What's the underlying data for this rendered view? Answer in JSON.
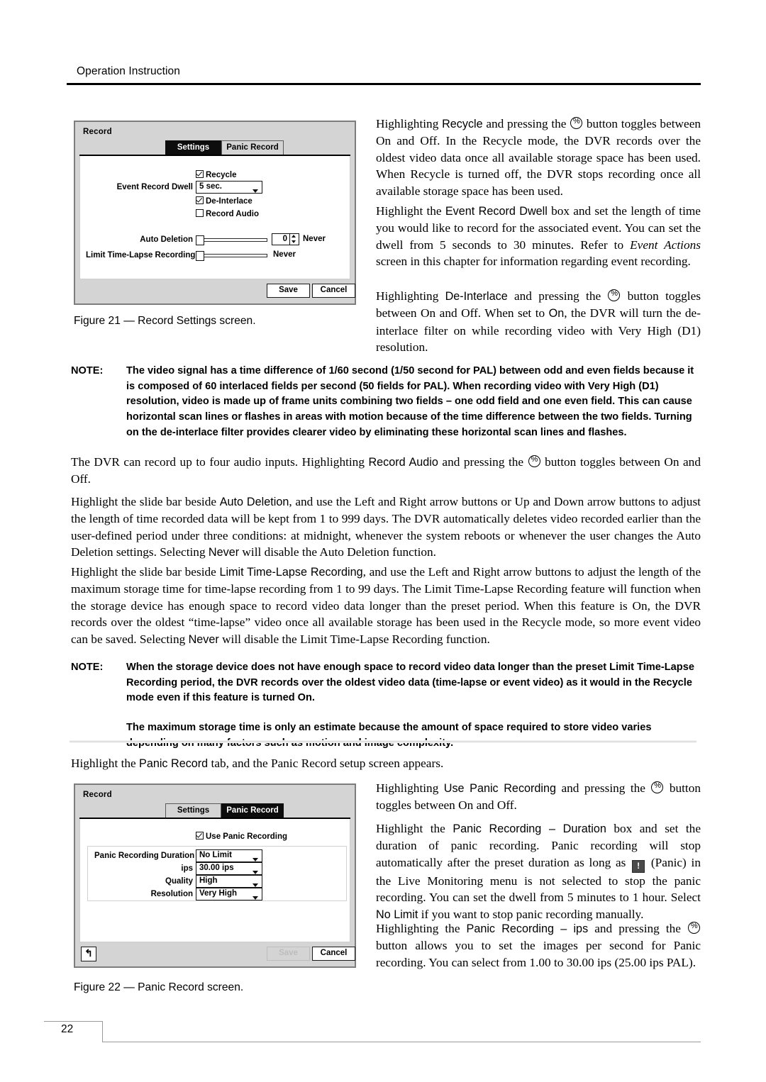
{
  "header": {
    "running_head": "Operation Instruction"
  },
  "paragraphs": {
    "p_recycle_1": "Highlighting ",
    "p_recycle_term": "Recycle",
    "p_recycle_2": " and pressing the ",
    "p_recycle_3": " button toggles between On and Off.  In the Recycle mode, the DVR records over the oldest video data once all available storage space has been used.  When Recycle is turned off, the DVR stops recording once all available storage space has been used.",
    "p_dwell_1": "Highlight the ",
    "p_dwell_term": "Event Record Dwell",
    "p_dwell_2": " box and set the length of time you would like to record for the associated event.  You can set the dwell from 5 seconds to 30 minutes.  Refer to ",
    "p_dwell_italic": "Event Actions",
    "p_dwell_3": " screen in this chapter for information regarding event recording.",
    "p_deint_1": "Highlighting ",
    "p_deint_term": "De-Interlace",
    "p_deint_2": " and pressing the ",
    "p_deint_3": " button toggles between On and Off.  When set to ",
    "p_deint_on": "On",
    "p_deint_4": ", the DVR will turn the de-interlace filter on while recording video with Very High (D1) resolution.",
    "p_audio_1": "The DVR can record up to four audio inputs.  Highlighting ",
    "p_audio_term": "Record Audio",
    "p_audio_2": " and pressing the ",
    "p_audio_3": " button toggles between On and Off.",
    "p_autodel_1": "Highlight the slide bar beside ",
    "p_autodel_term": "Auto Deletion",
    "p_autodel_2": ", and use the Left and Right arrow buttons or Up and Down arrow buttons to adjust the length of time recorded data will be kept from 1 to 999 days.  The DVR automatically deletes video recorded earlier than the user-defined period under three conditions: at midnight, whenever the system reboots or whenever the user changes the Auto Deletion settings.  Selecting ",
    "p_autodel_never": "Never",
    "p_autodel_3": " will disable the Auto Deletion function.",
    "p_limit_1": "Highlight the slide bar beside ",
    "p_limit_term": "Limit Time-Lapse Recording",
    "p_limit_2": ", and use the Left and Right arrow buttons to adjust the length of the maximum storage time for time-lapse recording from 1 to 99 days.  The Limit Time-Lapse Recording feature will function when the storage device has enough space to record video data longer than the preset period.  When this feature is On, the DVR records over the oldest “time-lapse” video once all available storage has been used in the Recycle mode, so more event video can be saved.  Selecting ",
    "p_limit_never": "Never",
    "p_limit_3": " will disable the Limit Time-Lapse Recording function.",
    "p_panictab_1": "Highlight the ",
    "p_panictab_term": "Panic Record",
    "p_panictab_2": " tab, and the Panic Record setup screen appears.",
    "p_usepanic_1": "Highlighting ",
    "p_usepanic_term": "Use Panic Recording",
    "p_usepanic_2": " and pressing the ",
    "p_usepanic_3": " button toggles between On and Off.",
    "p_duration_1": "Highlight the ",
    "p_duration_term": "Panic Recording – Duration",
    "p_duration_2": " box and set the duration of panic recording.  Panic recording will stop automatically after the preset duration as long as ",
    "p_duration_3": " (Panic) in the Live Monitoring menu is not selected to stop the panic recording.  You can set the dwell from 5 minutes to 1 hour.  Select ",
    "p_duration_nolimit": "No Limit",
    "p_duration_4": " if you want to stop panic recording manually.",
    "p_ips_1": "Highlighting the ",
    "p_ips_term": "Panic Recording – ips",
    "p_ips_2": " and pressing the ",
    "p_ips_3": " button allows you to set the images per second for Panic recording.  You can select from 1.00 to 30.00 ips (25.00 ips PAL)."
  },
  "notes": {
    "note_label": "NOTE:",
    "note1_body": "The video signal has a time difference of 1/60 second (1/50 second for PAL) between odd and even fields because it is composed of 60 interlaced fields per second (50 fields for PAL).  When recording video with Very High (D1) resolution, video is made up of frame units combining two fields – one odd field and one even field.  This can cause horizontal scan lines or flashes in areas with motion because of the time difference between the two fields.  Turning on the de-interlace filter provides clearer video by eliminating these horizontal scan lines and flashes.",
    "note2_body_1": "When the storage device does not have enough space to record video data longer than the preset Limit Time-Lapse Recording period, the DVR records over the oldest video data (time-lapse or event video) as it would in the Recycle mode even if this feature is turned On.",
    "note2_body_2": "The maximum storage time is only an estimate because the amount of space required to store video varies depending on many factors such as motion and image complexity."
  },
  "figure_captions": {
    "fig21": "Figure 21 — Record Settings screen.",
    "fig22": "Figure 22 — Panic Record screen."
  },
  "glyphs": {
    "enter_button": "%",
    "panic_button": "!",
    "back_arrow": "↰"
  },
  "dialog_settings": {
    "title": "Record",
    "tabs": [
      {
        "label": "Settings",
        "active": true
      },
      {
        "label": "Panic Record",
        "active": false
      }
    ],
    "recycle": {
      "label": "Recycle",
      "checked": true
    },
    "event_record_dwell": {
      "label": "Event Record Dwell",
      "value": "5 sec."
    },
    "de_interlace": {
      "label": "De-Interlace",
      "checked": true
    },
    "record_audio": {
      "label": "Record Audio",
      "checked": false
    },
    "auto_deletion": {
      "label": "Auto Deletion",
      "value": "0",
      "status": "Never"
    },
    "limit_time_lapse": {
      "label": "Limit Time-Lapse Recording",
      "status": "Never"
    },
    "buttons": {
      "save": "Save",
      "cancel": "Cancel"
    }
  },
  "dialog_panic": {
    "title": "Record",
    "tabs": [
      {
        "label": "Settings",
        "active": false
      },
      {
        "label": "Panic Record",
        "active": true
      }
    ],
    "use_panic_recording": {
      "label": "Use Panic Recording",
      "checked": true
    },
    "fields": [
      {
        "label": "Panic Recording Duration",
        "value": "No Limit"
      },
      {
        "label": "ips",
        "value": "30.00 ips"
      },
      {
        "label": "Quality",
        "value": "High"
      },
      {
        "label": "Resolution",
        "value": "Very High"
      }
    ],
    "buttons": {
      "save": "Save",
      "cancel": "Cancel",
      "back": "↰"
    }
  },
  "footer": {
    "page_number": "22"
  }
}
